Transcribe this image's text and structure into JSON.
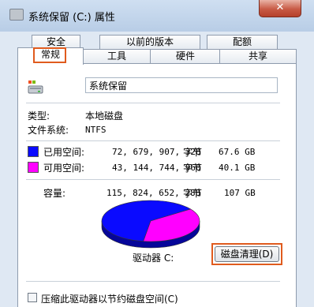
{
  "window": {
    "title": "系统保留 (C:) 属性",
    "close_label": "✕"
  },
  "tabs_row1": [
    {
      "label": "安全"
    },
    {
      "label": "以前的版本"
    },
    {
      "label": "配额"
    }
  ],
  "tabs_row2": [
    {
      "label": "常规"
    },
    {
      "label": "工具"
    },
    {
      "label": "硬件"
    },
    {
      "label": "共享"
    }
  ],
  "general": {
    "volume_name": "系统保留",
    "type_label": "类型:",
    "type_value": "本地磁盘",
    "fs_label": "文件系统:",
    "fs_value": "NTFS",
    "used": {
      "label": "已用空间:",
      "bytes": "72, 679, 907, 328",
      "unit": "字节",
      "size": "67.6 GB",
      "color": "#0a0aff"
    },
    "free": {
      "label": "可用空间:",
      "bytes": "43, 144, 744, 960",
      "unit": "字节",
      "size": "40.1 GB",
      "color": "#ff00ff"
    },
    "capacity": {
      "label": "容量:",
      "bytes": "115, 824, 652, 288",
      "unit": "字节",
      "size": "107 GB"
    },
    "drive_label": "驱动器 C:",
    "cleanup_button": "磁盘清理(D)",
    "compress_label": "压缩此驱动器以节约磁盘空间(C)"
  },
  "chart_data": {
    "type": "pie",
    "labels": [
      "已用空间",
      "可用空间"
    ],
    "values": [
      67.6,
      40.1
    ],
    "colors": [
      "#0a0aff",
      "#ff00ff"
    ]
  }
}
